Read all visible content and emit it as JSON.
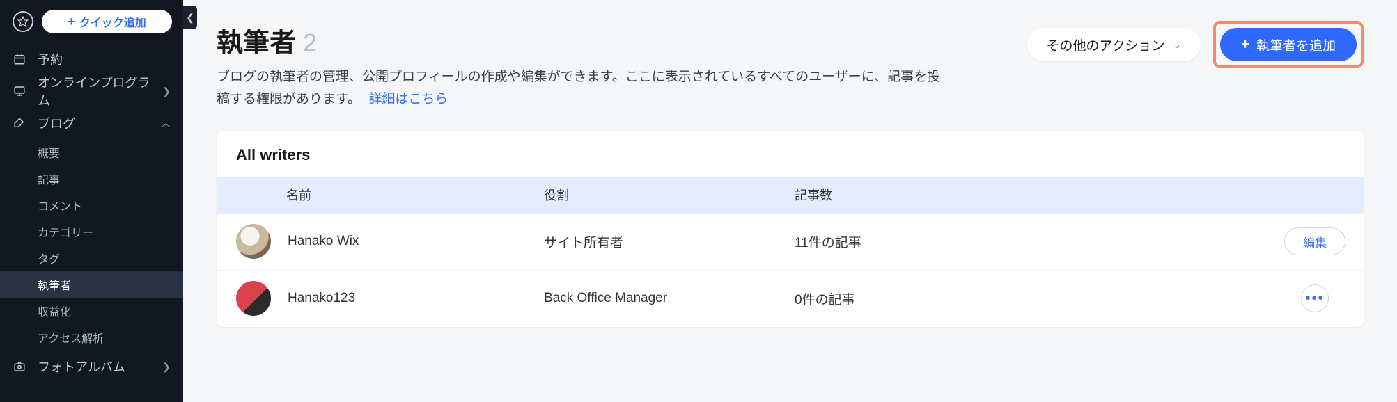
{
  "sidebar": {
    "quick_add_label": "クイック追加",
    "items": [
      {
        "icon": "calendar",
        "label": "予約",
        "chev": ""
      },
      {
        "icon": "monitor",
        "label": "オンラインプログラム",
        "chev": "›"
      },
      {
        "icon": "pen",
        "label": "ブログ",
        "chev": "expanded"
      },
      {
        "icon": "camera",
        "label": "フォトアルバム",
        "chev": "›"
      }
    ],
    "blog_sub": [
      {
        "label": "概要"
      },
      {
        "label": "記事"
      },
      {
        "label": "コメント"
      },
      {
        "label": "カテゴリー"
      },
      {
        "label": "タグ"
      },
      {
        "label": "執筆者",
        "active": true
      },
      {
        "label": "収益化"
      },
      {
        "label": "アクセス解析"
      }
    ]
  },
  "head": {
    "title": "執筆者",
    "count": "2",
    "desc": "ブログの執筆者の管理、公開プロフィールの作成や編集ができます。ここに表示されているすべてのユーザーに、記事を投稿する権限があります。",
    "learn_more": "詳細はこちら",
    "other_actions": "その他のアクション",
    "add_writer": "執筆者を追加"
  },
  "card": {
    "title": "All writers",
    "col_name": "名前",
    "col_role": "役割",
    "col_posts": "記事数",
    "edit_label": "編集",
    "rows": [
      {
        "name": "Hanako Wix",
        "role": "サイト所有者",
        "posts": "11件の記事",
        "action": "edit"
      },
      {
        "name": "Hanako123",
        "role": "Back Office Manager",
        "posts": "0件の記事",
        "action": "more"
      }
    ]
  }
}
